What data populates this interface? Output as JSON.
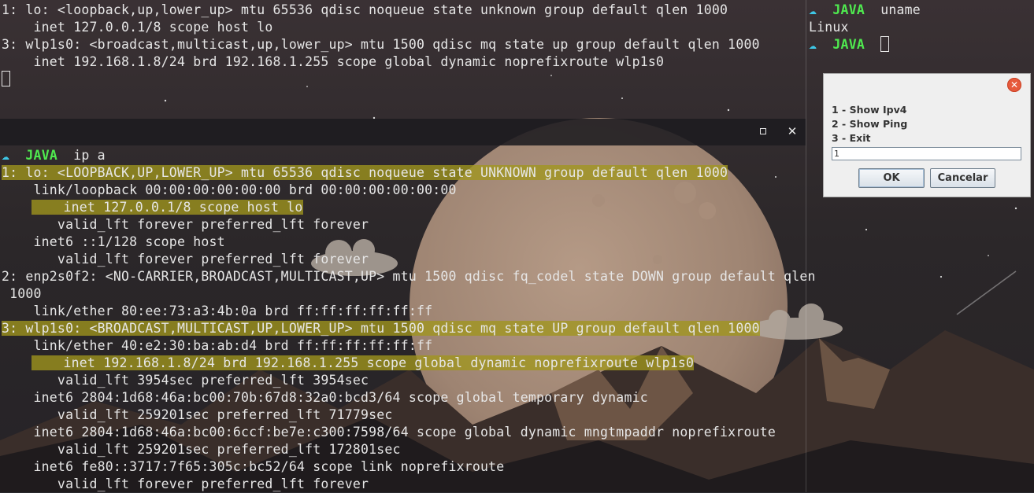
{
  "colors": {
    "highlight": "#a0961e",
    "prompt_cloud": "#3ec7e6",
    "prompt_java": "#4fe94f",
    "terminal_text": "#e6e6e6",
    "dialog_bg": "#efefef",
    "dialog_close": "#e65a3c"
  },
  "top_left_terminal": {
    "lines": [
      "1: lo: <loopback,up,lower_up> mtu 65536 qdisc noqueue state unknown group default qlen 1000",
      "    inet 127.0.0.1/8 scope host lo",
      "3: wlp1s0: <broadcast,multicast,up,lower_up> mtu 1500 qdisc mq state up group default qlen 1000",
      "    inet 192.168.1.8/24 brd 192.168.1.255 scope global dynamic noprefixroute wlp1s0"
    ]
  },
  "top_right_terminal": {
    "prompt_icon": "cloud-icon",
    "prompt_label": "JAVA",
    "command": "uname",
    "output": "Linux"
  },
  "bottom_terminal": {
    "titlebar": {
      "maximize_icon": "maximize-icon",
      "close_icon": "close-icon"
    },
    "prompt_label": "JAVA",
    "command": "ip a",
    "lines": [
      "1: lo: <LOOPBACK,UP,LOWER_UP> mtu 65536 qdisc noqueue state UNKNOWN group default qlen 1000",
      "    link/loopback 00:00:00:00:00:00 brd 00:00:00:00:00:00",
      "    inet 127.0.0.1/8 scope host lo",
      "       valid_lft forever preferred_lft forever",
      "    inet6 ::1/128 scope host",
      "       valid_lft forever preferred_lft forever",
      "2: enp2s0f2: <NO-CARRIER,BROADCAST,MULTICAST,UP> mtu 1500 qdisc fq_codel state DOWN group default qlen",
      " 1000",
      "    link/ether 80:ee:73:a3:4b:0a brd ff:ff:ff:ff:ff:ff",
      "3: wlp1s0: <BROADCAST,MULTICAST,UP,LOWER_UP> mtu 1500 qdisc mq state UP group default qlen 1000",
      "    link/ether 40:e2:30:ba:ab:d4 brd ff:ff:ff:ff:ff:ff",
      "    inet 192.168.1.8/24 brd 192.168.1.255 scope global dynamic noprefixroute wlp1s0",
      "       valid_lft 3954sec preferred_lft 3954sec",
      "    inet6 2804:1d68:46a:bc00:70b:67d8:32a0:bcd3/64 scope global temporary dynamic",
      "       valid_lft 259201sec preferred_lft 71779sec",
      "    inet6 2804:1d68:46a:bc00:6ccf:be7e:c300:7598/64 scope global dynamic mngtmpaddr noprefixroute",
      "       valid_lft 259201sec preferred_lft 172801sec",
      "    inet6 fe80::3717:7f65:305c:bc52/64 scope link noprefixroute",
      "       valid_lft forever preferred_lft forever"
    ]
  },
  "dialog": {
    "close_icon": "close-icon",
    "options": [
      "1 - Show Ipv4",
      "2 - Show Ping",
      "3 - Exit"
    ],
    "input_value": "1",
    "ok_label": "OK",
    "cancel_label": "Cancelar"
  }
}
